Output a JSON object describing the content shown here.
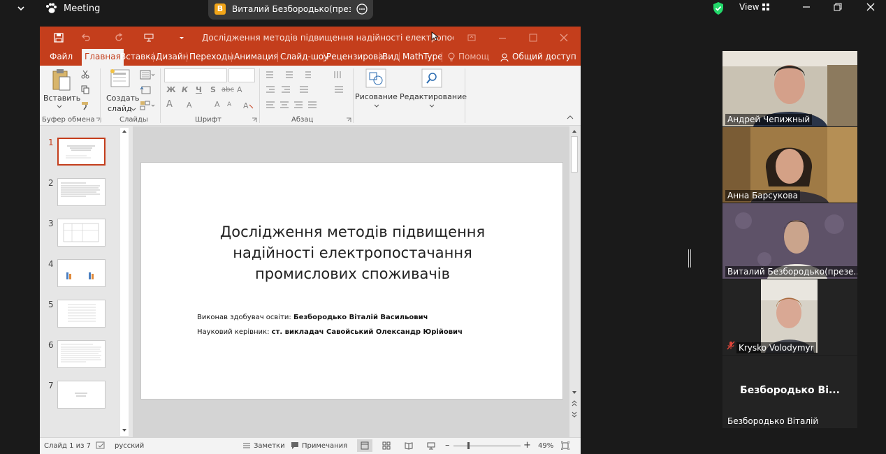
{
  "zoom": {
    "app_name": "Meeting",
    "share_avatar": "B",
    "share_name": "Виталий Безбородько(презента",
    "view_label": "View",
    "colors": {
      "accent_green": "#23d96b",
      "share_avatar": "#f2a518"
    }
  },
  "ppt": {
    "title": "Дослідження методів підвищення надійності електропостачан...",
    "tabs": [
      "Файл",
      "Главная",
      "Вставка",
      "Дизайн",
      "Переходы",
      "Анимация",
      "Слайд-шоу",
      "Рецензирова",
      "Вид",
      "MathType",
      "Помощ",
      "Общий доступ"
    ],
    "ribbon": {
      "paste": "Вставить",
      "new_slide": "Создать",
      "new_slide_2": "слайд",
      "bold": "Ж",
      "italic": "К",
      "underline": "Ч",
      "shadow": "S",
      "strike": "abc",
      "font_a": "A",
      "drawing": "Рисование",
      "editing": "Редактирование",
      "groups": [
        "Буфер обмена",
        "Слайды",
        "Шрифт",
        "Абзац"
      ]
    },
    "slide": {
      "title": "Дослідження методів підвищення надійності електропостачання промислових споживачів",
      "line1_label": "Виконав здобувач освіти:",
      "line1_value": "Безбородько Віталій Васильович",
      "line2_label": "Науковий керівник:",
      "line2_value": "ст. викладач Савойський Олександр Юрійович"
    },
    "thumbs": [
      "1",
      "2",
      "3",
      "4",
      "5",
      "6",
      "7"
    ],
    "status": {
      "slide_counter": "Слайд 1 из 7",
      "language": "русский",
      "notes": "Заметки",
      "comments": "Примечания",
      "zoom_minus": "–",
      "zoom_plus": "+",
      "zoom_level": "49%"
    },
    "colors": {
      "brand": "#c43e1c"
    }
  },
  "participants": [
    {
      "name": "Андрей Чепижный",
      "active_speaker": true
    },
    {
      "name": "Анна Барсукова"
    },
    {
      "name": "Виталий Безбородько(презе..."
    },
    {
      "name": "Krysko Volodymyr",
      "muted": true
    },
    {
      "big_name": "Безбородько  Ві...",
      "name": "Безбородько Віталій"
    }
  ]
}
